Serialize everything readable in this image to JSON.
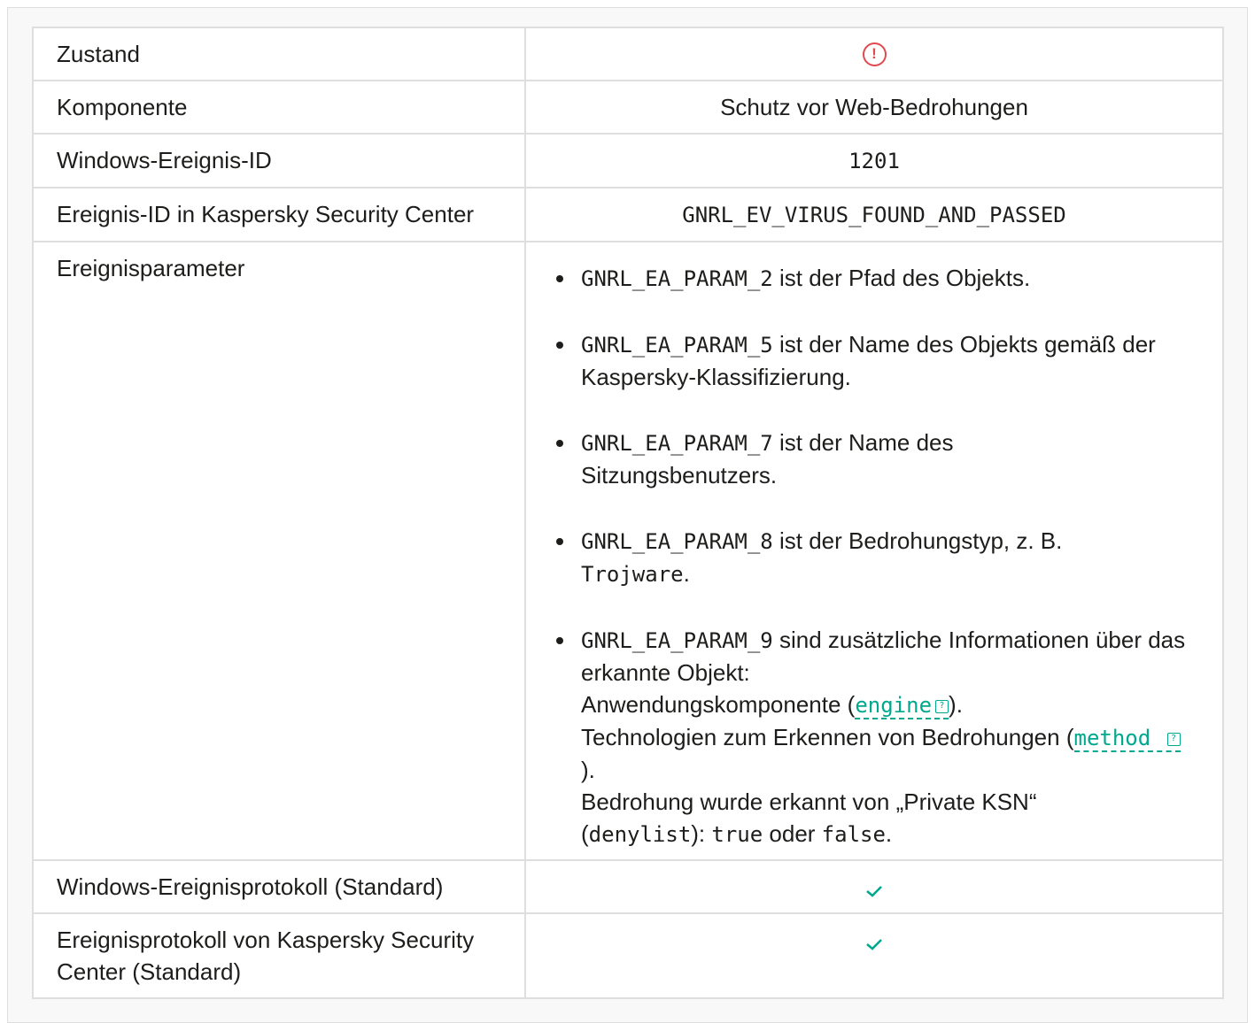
{
  "rows": {
    "state": {
      "label": "Zustand",
      "icon": "alert-circle-icon"
    },
    "component": {
      "label": "Komponente",
      "value": "Schutz vor Web-Bedrohungen"
    },
    "win_event_id": {
      "label": "Windows-Ereignis-ID",
      "value": "1201"
    },
    "ksc_event_id": {
      "label": "Ereignis-ID in Kaspersky Security Center",
      "value": "GNRL_EV_VIRUS_FOUND_AND_PASSED"
    },
    "params": {
      "label": "Ereignisparameter",
      "items": [
        {
          "code": "GNRL_EA_PARAM_2",
          "text": " ist der Pfad des Objekts."
        },
        {
          "code": "GNRL_EA_PARAM_5",
          "text": " ist der Name des Objekts gemäß der Kaspersky-Klassifizierung."
        },
        {
          "code": "GNRL_EA_PARAM_7",
          "text": " ist der Name des Sitzungsbenutzers."
        },
        {
          "code": "GNRL_EA_PARAM_8",
          "text": " ist der Bedrohungstyp, z. B. ",
          "code2": "Trojware",
          "tail": "."
        },
        {
          "code": "GNRL_EA_PARAM_9",
          "text": " sind zusätzliche Informationen über das erkannte Objekt:",
          "line2_pre": "Anwendungskomponente (",
          "line2_link": "engine",
          "line2_post": ").",
          "line3_pre": "Technologien zum Erkennen von Bedrohungen (",
          "line3_link": "method",
          "line3_post": ").",
          "line4": "Bedrohung wurde erkannt von „Private KSN“",
          "line5_open": "(",
          "line5_code1": "denylist",
          "line5_mid": "): ",
          "line5_code2": "true",
          "line5_or": " oder ",
          "line5_code3": "false",
          "line5_end": "."
        }
      ]
    },
    "win_log": {
      "label": "Windows-Ereignisprotokoll (Standard)",
      "icon": "check-icon"
    },
    "ksc_log": {
      "label": "Ereignisprotokoll von Kaspersky Security Center (Standard)",
      "icon": "check-icon"
    }
  },
  "colors": {
    "accent": "#00a88e",
    "alert": "#e0494f",
    "border": "#dedede"
  }
}
